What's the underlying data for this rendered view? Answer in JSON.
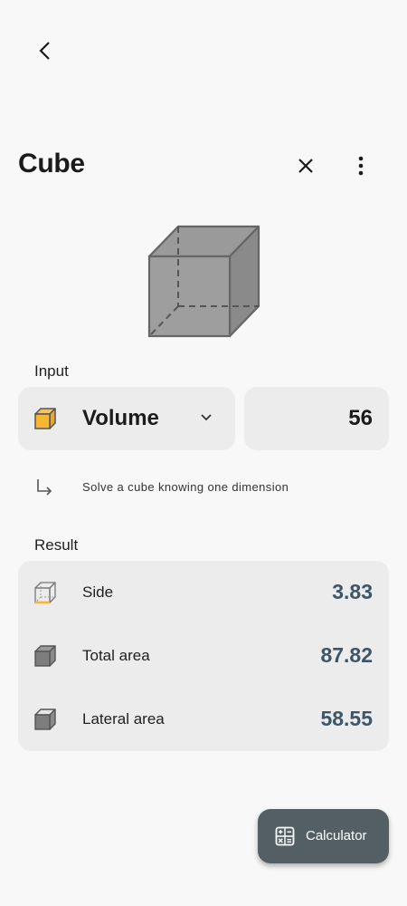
{
  "header": {
    "back_icon": "arrow-back-icon",
    "title": "Cube",
    "close_icon": "close-icon",
    "more_icon": "more-vert-icon"
  },
  "figure": {
    "icon": "cube-diagram"
  },
  "input": {
    "section_label": "Input",
    "dimension_selected": "Volume",
    "dimension_icon": "cube-volume-icon",
    "dropdown_icon": "chevron-down-icon",
    "value": "56",
    "hint_icon": "subdirectory-arrow-icon",
    "hint": "Solve a cube knowing one dimension"
  },
  "result": {
    "section_label": "Result",
    "rows": [
      {
        "icon": "cube-side-icon",
        "label": "Side",
        "value": "3.83"
      },
      {
        "icon": "cube-total-area-icon",
        "label": "Total area",
        "value": "87.82"
      },
      {
        "icon": "cube-lateral-area-icon",
        "label": "Lateral area",
        "value": "58.55"
      }
    ]
  },
  "fab": {
    "icon": "calculator-icon",
    "label": "Calculator"
  },
  "colors": {
    "background": "#f8f8f8",
    "card": "#ececec",
    "result_value": "#3d5568",
    "accent": "#f7b733",
    "fab": "#545f65"
  }
}
